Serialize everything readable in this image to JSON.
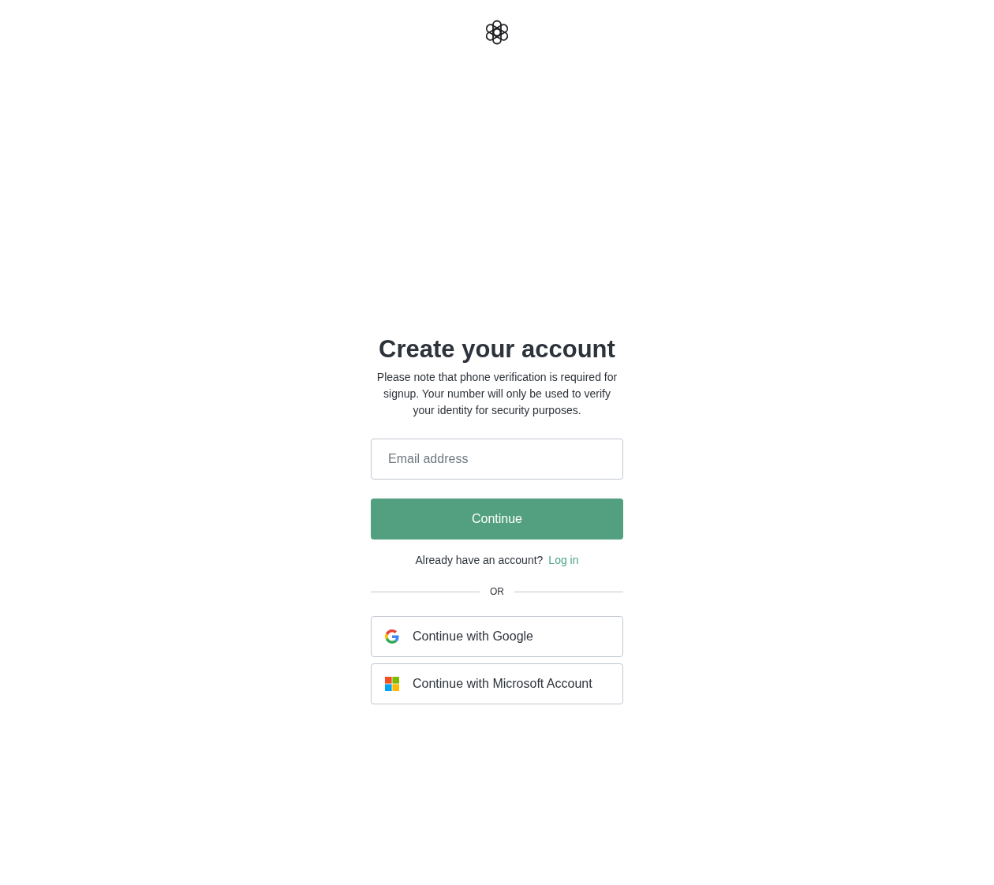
{
  "heading": "Create your account",
  "notice": "Please note that phone verification is required for signup. Your number will only be used to verify your identity for security purposes.",
  "email_field": {
    "placeholder": "Email address"
  },
  "continue_button": "Continue",
  "login_prompt": {
    "text": "Already have an account?",
    "link": "Log in"
  },
  "divider": "OR",
  "social_buttons": [
    {
      "kind": "google",
      "label": "Continue with Google"
    },
    {
      "kind": "microsoft",
      "label": "Continue with Microsoft Account"
    }
  ]
}
